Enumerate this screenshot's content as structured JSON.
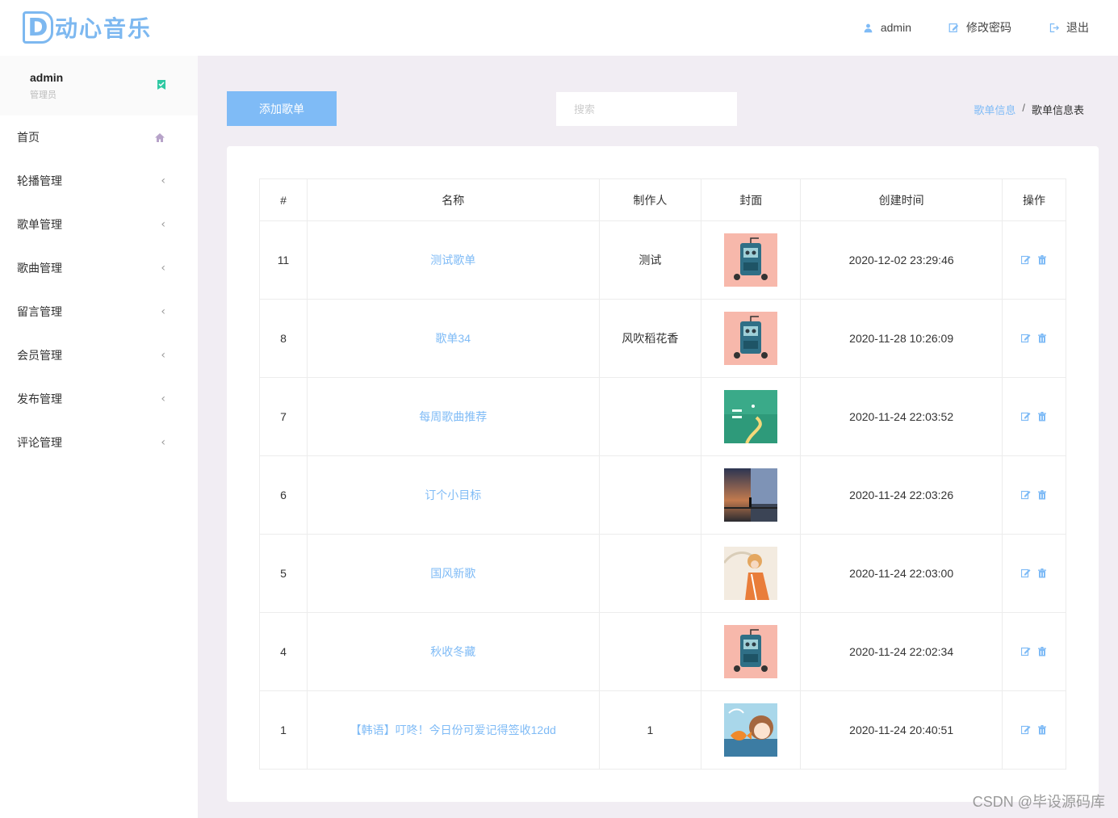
{
  "header": {
    "logo_letter": "D",
    "logo_text": "动心音乐",
    "user_link": "admin",
    "change_password": "修改密码",
    "logout": "退出"
  },
  "sidebar": {
    "user_name": "admin",
    "user_role": "管理员",
    "items": [
      {
        "label": "首页",
        "icon": "home-icon"
      },
      {
        "label": "轮播管理",
        "icon": "chevron-left-icon"
      },
      {
        "label": "歌单管理",
        "icon": "chevron-left-icon"
      },
      {
        "label": "歌曲管理",
        "icon": "chevron-left-icon"
      },
      {
        "label": "留言管理",
        "icon": "chevron-left-icon"
      },
      {
        "label": "会员管理",
        "icon": "chevron-left-icon"
      },
      {
        "label": "发布管理",
        "icon": "chevron-left-icon"
      },
      {
        "label": "评论管理",
        "icon": "chevron-left-icon"
      }
    ]
  },
  "toolbar": {
    "add_label": "添加歌单",
    "search_placeholder": "搜索"
  },
  "breadcrumb": {
    "parent": "歌单信息",
    "separator": "/",
    "current": "歌单信息表"
  },
  "table": {
    "headers": [
      "#",
      "名称",
      "制作人",
      "封面",
      "创建时间",
      "操作"
    ],
    "rows": [
      {
        "id": "11",
        "name": "测试歌单",
        "maker": "测试",
        "cover": "cassette-cover",
        "time": "2020-12-02 23:29:46"
      },
      {
        "id": "8",
        "name": "歌单34",
        "maker": "风吹稻花香",
        "cover": "cassette-cover",
        "time": "2020-11-28 10:26:09"
      },
      {
        "id": "7",
        "name": "每周歌曲推荐",
        "maker": "",
        "cover": "green-path-cover",
        "time": "2020-11-24 22:03:52"
      },
      {
        "id": "6",
        "name": "订个小目标",
        "maker": "",
        "cover": "sunset-cover",
        "time": "2020-11-24 22:03:26"
      },
      {
        "id": "5",
        "name": "国风新歌",
        "maker": "",
        "cover": "girl-umbrella-cover",
        "time": "2020-11-24 22:03:00"
      },
      {
        "id": "4",
        "name": "秋收冬藏",
        "maker": "",
        "cover": "cassette-cover",
        "time": "2020-11-24 22:02:34"
      },
      {
        "id": "1",
        "name": "【韩语】叮咚！今日份可爱记得签收12dd",
        "maker": "1",
        "cover": "girl-fish-cover",
        "time": "2020-11-24 20:40:51"
      }
    ]
  },
  "colors": {
    "accent": "#7fbbf6",
    "background": "#f1edf3"
  },
  "watermark": "CSDN @毕设源码库"
}
